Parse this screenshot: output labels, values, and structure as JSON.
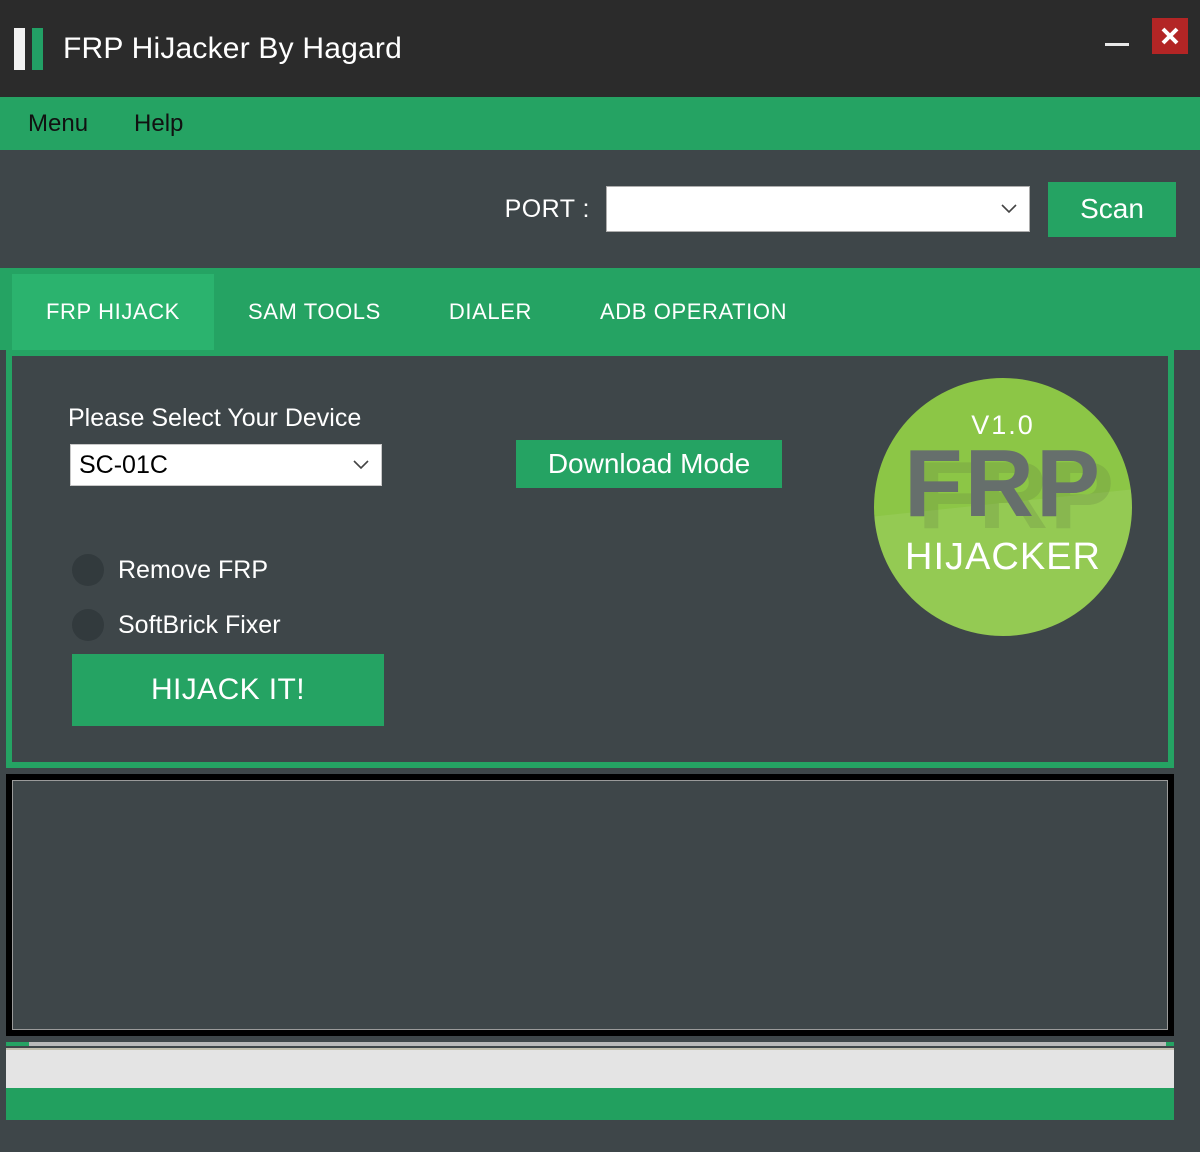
{
  "window": {
    "title": "FRP HiJacker By Hagard",
    "logo_icon": "double-bar-logo-icon",
    "minimize_icon": "minimize-icon",
    "close_icon": "close-icon",
    "titlebar_bg": "#2b2b2b",
    "accent_green": "#25a363",
    "panel_bg": "#3e4649",
    "close_button_bg": "#b32525"
  },
  "menubar": {
    "items": [
      {
        "label": "Menu"
      },
      {
        "label": "Help"
      }
    ]
  },
  "port_row": {
    "label": "PORT :",
    "combo_value": "",
    "combo_placeholder": "",
    "chevron_icon": "chevron-down-icon",
    "scan_label": "Scan"
  },
  "tabs": [
    {
      "label": "FRP HIJACK",
      "active": true
    },
    {
      "label": "SAM TOOLS",
      "active": false
    },
    {
      "label": "DIALER",
      "active": false
    },
    {
      "label": "ADB OPERATION",
      "active": false
    }
  ],
  "frp_hijack_tab": {
    "device_label": "Please Select Your Device",
    "device_value": "SC-01C",
    "device_chevron_icon": "chevron-down-icon",
    "download_mode_label": "Download Mode",
    "radios": [
      {
        "label": "Remove FRP",
        "selected": false
      },
      {
        "label": "SoftBrick Fixer",
        "selected": false
      }
    ],
    "hijack_label": "HIJACK IT!"
  },
  "brand_badge": {
    "version": "V1.0",
    "name_top": "FRP",
    "name_bottom": "HIJACKER",
    "circle_color": "#8cc646",
    "frp_text_color": "#666f6c"
  },
  "log": {
    "content": ""
  },
  "progress": {
    "percent": 2
  },
  "status": {
    "text": ""
  }
}
